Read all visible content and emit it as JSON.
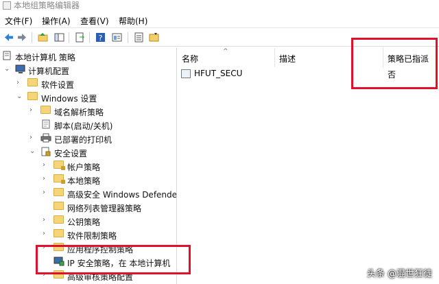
{
  "window": {
    "title": "本地组策略编辑器"
  },
  "menu": [
    "文件(F)",
    "操作(A)",
    "查看(V)",
    "帮助(H)"
  ],
  "tree": [
    {
      "label": "本地计算机 策略",
      "level": 0,
      "toggle": "",
      "icon": "computer-policy-icon"
    },
    {
      "label": "计算机配置",
      "level": 0,
      "toggle": "v",
      "icon": "computer-config-icon"
    },
    {
      "label": "软件设置",
      "level": 1,
      "toggle": ">",
      "icon": "folder-icon"
    },
    {
      "label": "Windows 设置",
      "level": 1,
      "toggle": "v",
      "icon": "folder-icon"
    },
    {
      "label": "域名解析策略",
      "level": 2,
      "toggle": ">",
      "icon": "folder-icon"
    },
    {
      "label": "脚本(启动/关机)",
      "level": 2,
      "toggle": "",
      "icon": "script-icon"
    },
    {
      "label": "已部署的打印机",
      "level": 2,
      "toggle": ">",
      "icon": "printer-icon"
    },
    {
      "label": "安全设置",
      "level": 2,
      "toggle": "v",
      "icon": "security-icon"
    },
    {
      "label": "帐户策略",
      "level": 3,
      "toggle": ">",
      "icon": "folder-lock-icon"
    },
    {
      "label": "本地策略",
      "level": 3,
      "toggle": ">",
      "icon": "folder-lock-icon"
    },
    {
      "label": "高级安全 Windows Defende",
      "level": 3,
      "toggle": ">",
      "icon": "folder-icon"
    },
    {
      "label": "网络列表管理器策略",
      "level": 3,
      "toggle": "",
      "icon": "folder-icon"
    },
    {
      "label": "公钥策略",
      "level": 3,
      "toggle": ">",
      "icon": "folder-icon"
    },
    {
      "label": "软件限制策略",
      "level": 3,
      "toggle": ">",
      "icon": "folder-icon"
    },
    {
      "label": "应用程序控制策略",
      "level": 3,
      "toggle": ">",
      "icon": "folder-icon"
    },
    {
      "label": "IP 安全策略，在 本地计算机",
      "level": 3,
      "toggle": "",
      "icon": "ip-security-icon"
    },
    {
      "label": "高级审核策略配置",
      "level": 3,
      "toggle": ">",
      "icon": "folder-icon"
    }
  ],
  "list": {
    "columns": [
      "名称",
      "描述",
      "策略已指派"
    ],
    "rows": [
      {
        "name": "HFUT_SECU",
        "description": "",
        "assigned": "否"
      }
    ]
  },
  "watermark": "头条 @混世狂徒",
  "colors": {
    "highlight": "#e0102a",
    "folder": "#f6d57a"
  }
}
